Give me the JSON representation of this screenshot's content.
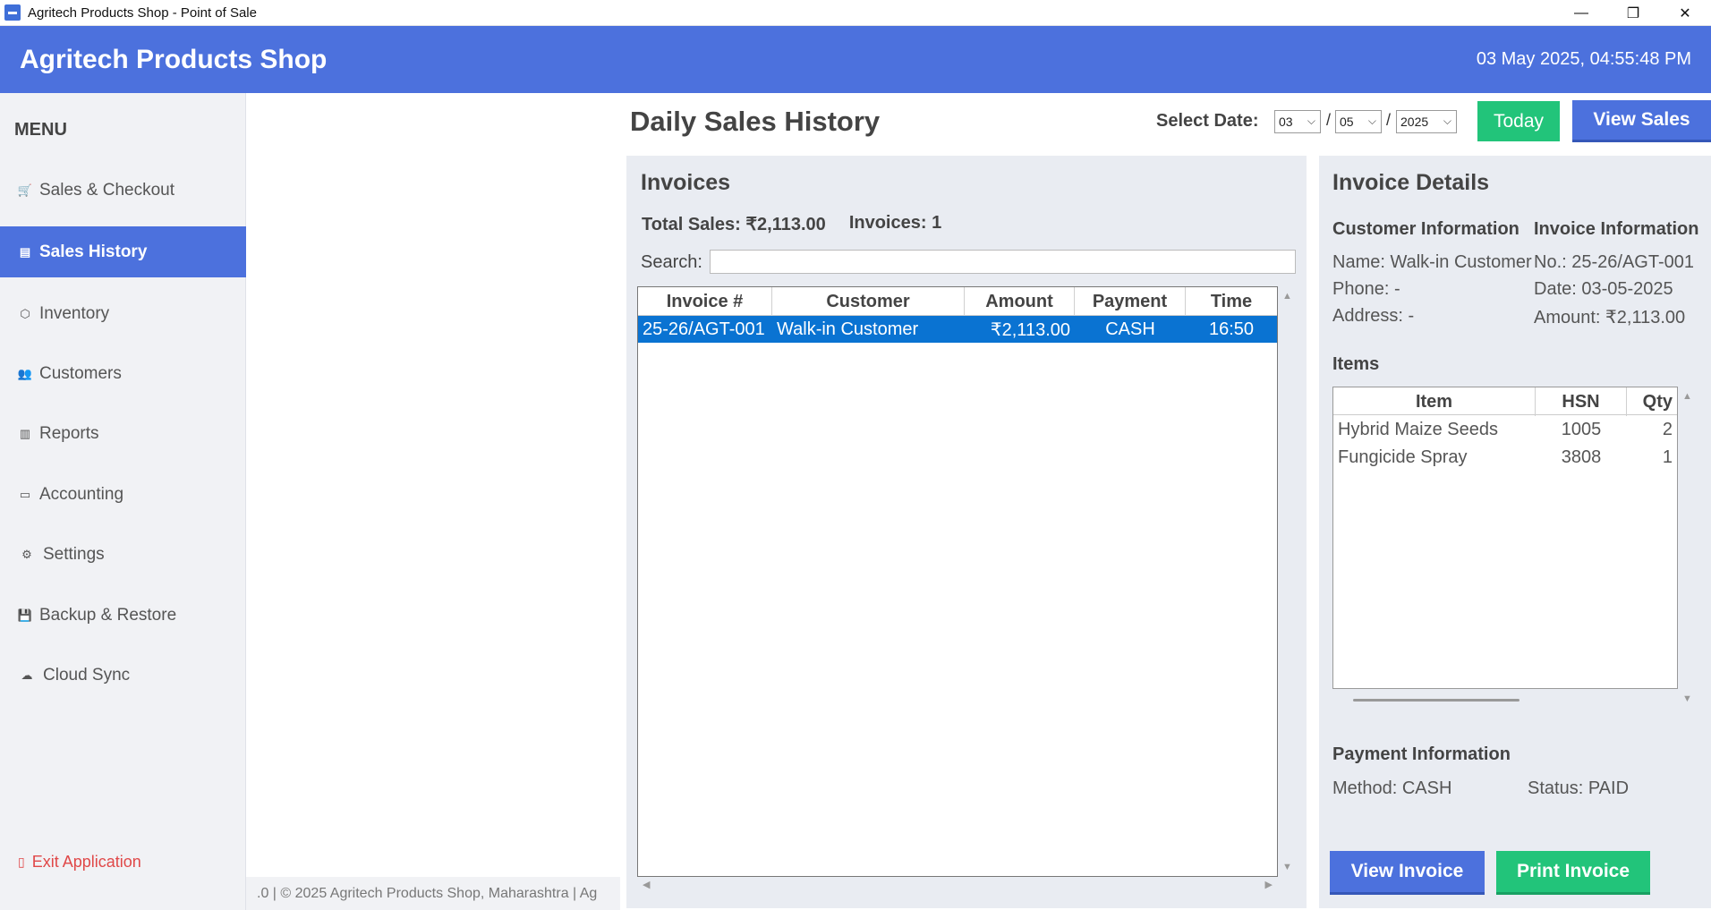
{
  "window": {
    "title": "Agritech Products Shop - Point of Sale",
    "min": "—",
    "max": "❐",
    "close": "✕"
  },
  "header": {
    "brand": "Agritech Products Shop",
    "datetime": "03 May 2025, 04:55:48 PM"
  },
  "sidebar": {
    "menu_title": "MENU",
    "items": [
      {
        "label": "Sales & Checkout",
        "icon": "cart-icon"
      },
      {
        "label": "Sales History",
        "icon": "receipt-icon",
        "active": true
      },
      {
        "label": "Inventory",
        "icon": "box-icon"
      },
      {
        "label": "Customers",
        "icon": "users-icon"
      },
      {
        "label": "Reports",
        "icon": "bar-chart-icon"
      },
      {
        "label": "Accounting",
        "icon": "ledger-icon"
      },
      {
        "label": "Settings",
        "icon": "gear-icon"
      },
      {
        "label": "Backup & Restore",
        "icon": "save-icon"
      },
      {
        "label": "Cloud Sync",
        "icon": "cloud-icon"
      }
    ],
    "exit_label": "Exit Application"
  },
  "footer": {
    "text": ".0 | © 2025 Agritech Products Shop, Maharashtra | Ag"
  },
  "main": {
    "title": "Daily Sales History",
    "date_label": "Select Date:",
    "day": "03",
    "month": "05",
    "year": "2025",
    "separator": "/",
    "today_button": "Today",
    "view_sales_button": "View Sales"
  },
  "invoices": {
    "title": "Invoices",
    "total_sales": "Total Sales: ₹2,113.00",
    "count": "Invoices: 1",
    "search_label": "Search:",
    "search_value": "",
    "columns": [
      "Invoice #",
      "Customer",
      "Amount",
      "Payment",
      "Time"
    ],
    "rows": [
      {
        "invoice": "25-26/AGT-001",
        "customer": "Walk-in Customer",
        "amount": "₹2,113.00",
        "payment": "CASH",
        "time": "16:50"
      }
    ]
  },
  "details": {
    "title": "Invoice Details",
    "customer_heading": "Customer Information",
    "invoice_heading": "Invoice Information",
    "customer_name": "Name: Walk-in Customer",
    "customer_phone": "Phone: -",
    "customer_address": "Address: -",
    "invoice_no": "No.: 25-26/AGT-001",
    "invoice_date": "Date: 03-05-2025",
    "invoice_amount": "Amount: ₹2,113.00",
    "items_heading": "Items",
    "item_columns": [
      "Item",
      "HSN",
      "Qty"
    ],
    "items": [
      {
        "item": "Hybrid Maize Seeds",
        "hsn": "1005",
        "qty": "2"
      },
      {
        "item": "Fungicide Spray",
        "hsn": "3808",
        "qty": "1"
      }
    ],
    "payment_heading": "Payment Information",
    "payment_method": "Method: CASH",
    "payment_status": "Status: PAID",
    "view_invoice_button": "View Invoice",
    "print_invoice_button": "Print Invoice"
  },
  "colors": {
    "accent": "#4c71dd",
    "success": "#22c47a",
    "selection": "#0a73d2",
    "danger": "#e04848"
  }
}
